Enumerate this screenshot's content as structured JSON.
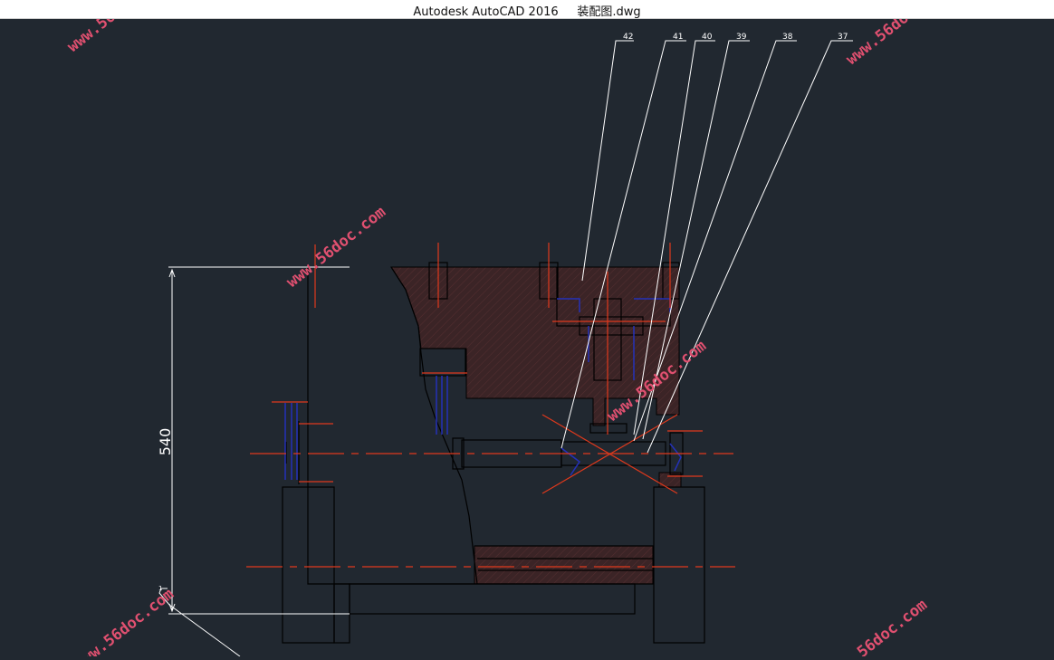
{
  "window": {
    "app_name": "Autodesk AutoCAD 2016",
    "file_name": "装配图.dwg"
  },
  "drawing": {
    "dimension_value": "540",
    "callout_labels": [
      "42",
      "41",
      "40",
      "39",
      "38",
      "37"
    ],
    "corner_label": "1"
  },
  "watermark": "www.56doc.com",
  "colors": {
    "background": "#212830",
    "outline": "#000000",
    "white_line": "#ffffff",
    "center_line": "#e0391c",
    "hatch": "#3b2426",
    "hidden_line": "#2431b8",
    "watermark": "#e05070"
  }
}
